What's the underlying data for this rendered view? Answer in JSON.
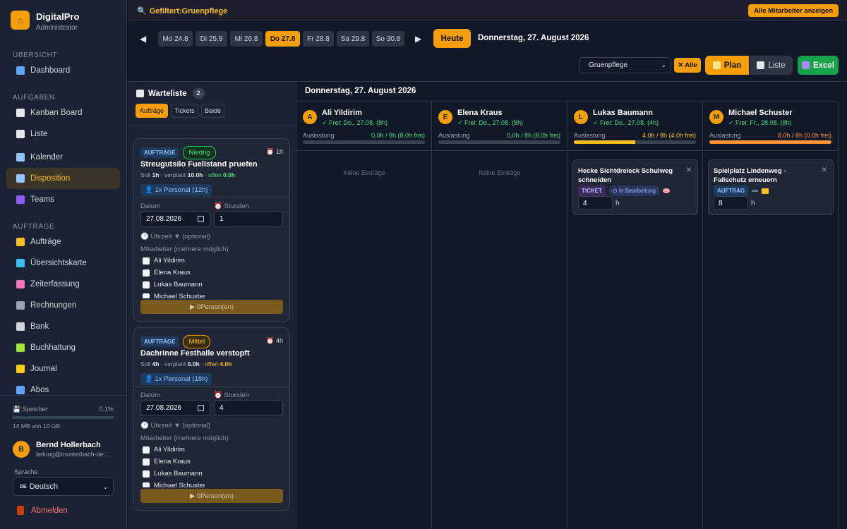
{
  "app": {
    "name": "DigitalPro",
    "role": "Administrator"
  },
  "sidebar": {
    "sections": [
      {
        "title": "Übersicht",
        "items": [
          {
            "label": "Dashboard",
            "icon": "chart-icon",
            "color": "#60a5fa"
          }
        ]
      },
      {
        "title": "Aufgaben",
        "items": [
          {
            "label": "Kanban Board",
            "icon": "clipboard-icon",
            "color": "#e5e7eb"
          },
          {
            "label": "Liste",
            "icon": "document-icon",
            "color": "#e5e7eb"
          },
          {
            "label": "Kalender",
            "icon": "calendar-icon",
            "color": "#93c5fd"
          },
          {
            "label": "Disposition",
            "icon": "calendar-icon",
            "color": "#93c5fd",
            "active": true
          },
          {
            "label": "Teams",
            "icon": "people-icon",
            "color": "#8b5cf6"
          }
        ]
      },
      {
        "title": "Aufträge",
        "items": [
          {
            "label": "Aufträge",
            "icon": "folder-icon",
            "color": "#fbbf24"
          },
          {
            "label": "Übersichtskarte",
            "icon": "map-icon",
            "color": "#38bdf8"
          },
          {
            "label": "Zeiterfassung",
            "icon": "clock-icon",
            "color": "#f472b6"
          },
          {
            "label": "Rechnungen",
            "icon": "invoice-icon",
            "color": "#9ca3af"
          },
          {
            "label": "Bank",
            "icon": "bank-icon",
            "color": "#d1d5db"
          },
          {
            "label": "Buchhaltung",
            "icon": "ledger-icon",
            "color": "#a3e635"
          },
          {
            "label": "Journal",
            "icon": "journal-icon",
            "color": "#facc15"
          },
          {
            "label": "Abos",
            "icon": "subscription-icon",
            "color": "#60a5fa"
          }
        ]
      }
    ],
    "storage": {
      "label": "Speicher",
      "percent_text": "0.1%",
      "fraction": 0.01,
      "size_text": "14 MB von 10 GB"
    },
    "user": {
      "initial": "B",
      "name": "Bernd Hollerbach",
      "email": "leitung@musterbach-de..."
    },
    "language": {
      "label": "Sprache",
      "flag": "DE",
      "value": "Deutsch"
    },
    "logout": "Abmelden"
  },
  "topbar": {
    "filter": "Gefiltert:Gruenpflege",
    "show_all": "Alle Mitarbeiter anzeigen"
  },
  "week": {
    "days": [
      {
        "label": "Mo 24.8"
      },
      {
        "label": "Di 25.8"
      },
      {
        "label": "Mi 26.8"
      },
      {
        "label": "Do 27.8",
        "selected": true
      },
      {
        "label": "Fr 28.8"
      },
      {
        "label": "Sa 29.8"
      },
      {
        "label": "So 30.8"
      }
    ],
    "today": "Heute",
    "current_date": "Donnerstag, 27. August 2026"
  },
  "controls": {
    "team_select": "Gruenpflege",
    "alle": "Alle",
    "plan": "Plan",
    "liste": "Liste",
    "excel": "Excel"
  },
  "waitlist": {
    "title": "Warteliste",
    "count": "2",
    "tabs": [
      "Aufträge",
      "Tickets",
      "Beide"
    ],
    "cards": [
      {
        "type": "AUFTRÄGE",
        "priority": "Niedrig",
        "hours": "1h",
        "title": "Streugutsilo Fuellstand pruefen",
        "soll": "1h",
        "verplant": "10.0h",
        "offen": "0.0h",
        "personal": "1x Personal (12h)",
        "datum_label": "Datum",
        "datum": "27.08.2026",
        "stunden_label": "Stunden",
        "stunden": "1",
        "uhrzeit": "Uhrzeit ▼ (optional)",
        "mitarbeiter_label": "Mitarbeiter (mehrere möglich):",
        "employees": [
          "Ali Yildirim",
          "Elena Kraus",
          "Lukas Baumann",
          "Michael Schuster"
        ],
        "assign": "▶ 0Person(en)"
      },
      {
        "type": "AUFTRÄGE",
        "priority": "Mittel",
        "hours": "4h",
        "title": "Dachrinne Festhalle verstopft",
        "soll": "4h",
        "verplant": "0.0h",
        "offen": "4.0h",
        "personal": "1x Personal (18h)",
        "datum_label": "Datum",
        "datum": "27.08.2026",
        "stunden_label": "Stunden",
        "stunden": "4",
        "uhrzeit": "Uhrzeit ▼ (optional)",
        "mitarbeiter_label": "Mitarbeiter (mehrere möglich):",
        "employees": [
          "Ali Yildirim",
          "Elena Kraus",
          "Lukas Baumann",
          "Michael Schuster"
        ],
        "assign": "▶ 0Person(en)"
      }
    ]
  },
  "plan": {
    "date_title": "Donnerstag, 27. August 2026",
    "auslastung_label": "Auslastung",
    "employees": [
      {
        "initial": "A",
        "name": "Ali Yildirim",
        "free": "✓ Frei: Do., 27.08. (8h)",
        "load": "0.0h / 8h (8.0h frei)",
        "fraction": 0,
        "color": "#4ade80",
        "empty": "Keine Einträge"
      },
      {
        "initial": "E",
        "name": "Elena Kraus",
        "free": "✓ Frei: Do., 27.08. (8h)",
        "load": "0.0h / 8h (8.0h frei)",
        "fraction": 0,
        "color": "#4ade80",
        "empty": "Keine Einträge"
      },
      {
        "initial": "L",
        "name": "Lukas Baumann",
        "free": "✓ Frei: Do., 27.08. (4h)",
        "load": "4.0h / 8h (4.0h frei)",
        "fraction": 0.5,
        "color": "#fbbf24",
        "entry": {
          "title": "Hecke Sichtdreieck Schulweg schneiden",
          "badge": "TICKET",
          "state": "⊙ In Bearbeitung",
          "hours": "4",
          "unit": "h"
        }
      },
      {
        "initial": "M",
        "name": "Michael Schuster",
        "free": "✓ Frei: Fr., 28.08. (8h)",
        "load": "8.0h / 8h (0.0h frei)",
        "fraction": 1,
        "color": "#fb923c",
        "entry": {
          "title": "Spielplatz Lindenweg - Fallschutz erneuern",
          "badge": "AUFTRAG",
          "hours": "8",
          "unit": "h"
        }
      }
    ]
  }
}
